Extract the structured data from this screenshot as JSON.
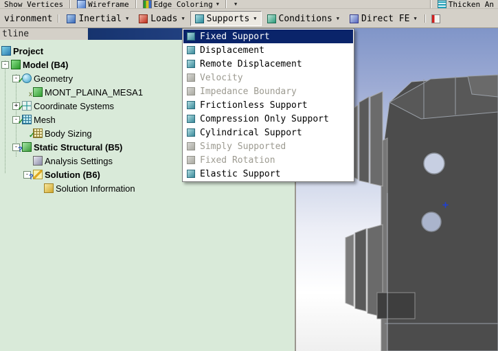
{
  "icons": {
    "collapse": "-",
    "expand": "+",
    "check": "✓",
    "question": "?",
    "suppressed": "x",
    "dropdown_arrow": "▼",
    "selection_marker": "+"
  },
  "colors": {
    "menu_highlight": "#0a246a",
    "tree_bg": "#d9ead9",
    "toolbar_bg": "#d4d0c8",
    "viewport_top": "#8095c8"
  },
  "toolbar_top": {
    "show_vertices": "Show Vertices",
    "wireframe": "Wireframe",
    "edge_coloring": "Edge Coloring",
    "thicken": "Thicken An"
  },
  "toolbar_env": {
    "environment": "vironment",
    "inertial": "Inertial",
    "loads": "Loads",
    "supports": "Supports",
    "conditions": "Conditions",
    "direct_fe": "Direct FE"
  },
  "outline": {
    "header": "tline"
  },
  "supports_menu": {
    "items": [
      {
        "label": "Fixed Support",
        "state": "selected"
      },
      {
        "label": "Displacement",
        "state": "enabled"
      },
      {
        "label": "Remote Displacement",
        "state": "enabled"
      },
      {
        "label": "Velocity",
        "state": "disabled"
      },
      {
        "label": "Impedance Boundary",
        "state": "disabled"
      },
      {
        "label": "Frictionless Support",
        "state": "enabled"
      },
      {
        "label": "Compression Only Support",
        "state": "enabled"
      },
      {
        "label": "Cylindrical Support",
        "state": "enabled"
      },
      {
        "label": "Simply Supported",
        "state": "disabled"
      },
      {
        "label": "Fixed Rotation",
        "state": "disabled"
      },
      {
        "label": "Elastic Support",
        "state": "enabled"
      }
    ]
  },
  "tree": {
    "items": [
      {
        "label": "Project"
      },
      {
        "label": "Model (B4)"
      },
      {
        "label": "Geometry"
      },
      {
        "label": "MONT_PLAINA_MESA1"
      },
      {
        "label": "Coordinate Systems"
      },
      {
        "label": "Mesh"
      },
      {
        "label": "Body Sizing"
      },
      {
        "label": "Static Structural (B5)"
      },
      {
        "label": "Analysis Settings"
      },
      {
        "label": "Solution (B6)"
      },
      {
        "label": "Solution Information"
      }
    ]
  }
}
